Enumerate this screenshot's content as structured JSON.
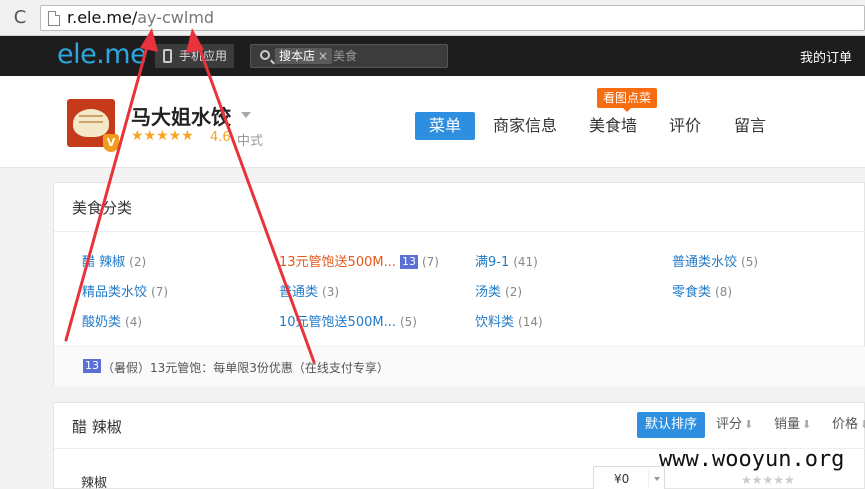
{
  "browser": {
    "url_host": "r.ele.me/",
    "url_path": "ay-cwlmd",
    "reload_glyph": "C"
  },
  "topnav": {
    "logo": "ele.me",
    "mobile_app_label": "手机应用",
    "search_scope": "搜本店",
    "search_scope_close": "×",
    "search_placeholder": "美食",
    "my_orders": "我的订单"
  },
  "store": {
    "name": "马大姐水饺",
    "stars": "★★★★★",
    "rating": "4.6",
    "cuisine": "中式",
    "badge_glyph": "V",
    "tabs": {
      "menu": "菜单",
      "info": "商家信息",
      "food_wall": "美食墙",
      "reviews": "评价",
      "messages": "留言"
    },
    "food_wall_badge": "看图点菜"
  },
  "categories": {
    "title": "美食分类",
    "items": [
      {
        "label": "醋 辣椒",
        "count": "(2)"
      },
      {
        "label": "13元管饱送500M...",
        "count": "(7)",
        "badge": "13"
      },
      {
        "label": "满9-1",
        "count": "(41)"
      },
      {
        "label": "普通类水饺",
        "count": "(5)"
      },
      {
        "label": "精品类水饺",
        "count": "(7)"
      },
      {
        "label": "普通类",
        "count": "(3)"
      },
      {
        "label": "汤类",
        "count": "(2)"
      },
      {
        "label": "零食类",
        "count": "(8)"
      },
      {
        "label": "酸奶类",
        "count": "(4)"
      },
      {
        "label": "10元管饱送500M...",
        "count": "(5)"
      },
      {
        "label": "饮料类",
        "count": "(14)"
      }
    ],
    "promo_badge": "13",
    "promo_text": "（暑假）13元管饱：每单限3份优惠（在线支付专享）"
  },
  "dishes": {
    "section_title": "醋 辣椒",
    "sort": {
      "default": "默认排序",
      "score": "评分",
      "sales": "销量",
      "price": "价格",
      "arrow": "⬇"
    },
    "first_dish": {
      "name": "辣椒",
      "price": "¥0",
      "stars": "★★★★★"
    }
  },
  "watermark": "www.wooyun.org",
  "colors": {
    "accent": "#2e8fe0",
    "promo_orange": "#f76c10",
    "arrow_red": "#e8323c"
  }
}
